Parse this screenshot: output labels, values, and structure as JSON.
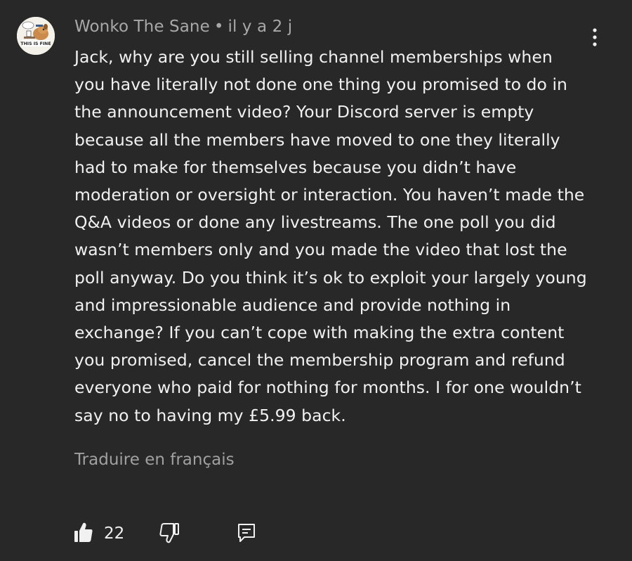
{
  "comment": {
    "author": "Wonko The Sane",
    "separator": "•",
    "timestamp": "il y a 2 j",
    "avatar": {
      "icon": "this-is-fine-dog-avatar",
      "caption": "THIS IS FINE"
    },
    "text": "Jack, why are you still selling channel memberships when you have literally not done one thing you promised to do in the announcement video? Your Discord server is empty because all the members have moved to one they literally had to make for themselves because you didn’t have moderation or oversight or interaction. You haven’t made the Q&A videos or done any livestreams. The one poll you did wasn’t members only and you made the video that lost the poll anyway. Do you think it’s ok to exploit your largely young and impressionable audience and provide nothing in exchange? If you can’t cope with making the extra content you promised, cancel the membership program and refund everyone who paid for nothing for months. I for one wouldn’t say no to having my £5.99 back.",
    "translate_label": "Traduire en français",
    "more_icon": "more-vertical-icon"
  },
  "actions": {
    "like_icon": "thumbs-up-icon",
    "like_count": "22",
    "dislike_icon": "thumbs-down-icon",
    "reply_icon": "reply-icon"
  },
  "colors": {
    "background": "#282828",
    "text": "#f1f1f1",
    "secondary_text": "#a8a8a8"
  }
}
